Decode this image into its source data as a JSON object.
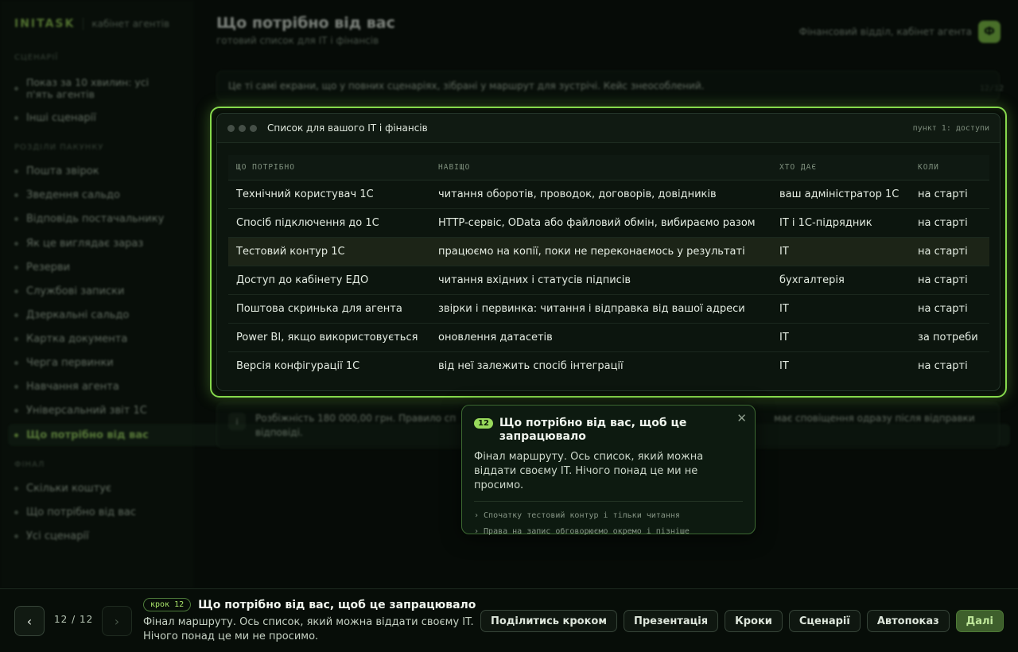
{
  "brand": {
    "logo": "INITASK",
    "subtitle": "кабінет агентів"
  },
  "sidebar": {
    "sections": {
      "scenarios": "СЦЕНАРІЇ",
      "package": "РОЗДІЛИ ПАКУНКУ",
      "next": "ФІНАЛ"
    },
    "scenario_items": [
      {
        "label": "Показ за 10 хвилин: усі п'ять агентів",
        "count": "12/12"
      },
      {
        "label": "Інші сценарії"
      }
    ],
    "items": [
      "Пошта звірок",
      "Зведення сальдо",
      "Відповідь постачальнику",
      "Як це виглядає зараз",
      "Резерви",
      "Службові записки",
      "Дзеркальні сальдо",
      "Картка документа",
      "Черга первинки",
      "Навчання агента",
      "Універсальний звіт 1С",
      "Що потрібно від вас"
    ],
    "final_items": [
      "Скільки коштує",
      "Що потрібно від вас",
      "Усі сценарії"
    ]
  },
  "header": {
    "title": "Що потрібно від вас",
    "subtitle": "готовий список для IT і фінансів",
    "right_label": "Фінансовий відділ, кабінет агента",
    "avatar": "Ф"
  },
  "notice": "Це ті самі екрани, що у повних сценаріях, зібрані у маршрут для зустрічі. Кейс знеособлений.",
  "panel": {
    "title": "Список для вашого IT і фінансів",
    "tag": "пункт 1: доступи",
    "columns": [
      "ЩО ПОТРІБНО",
      "НАВІЩО",
      "ХТО ДАЄ",
      "КОЛИ"
    ],
    "rows": [
      [
        "Технічний користувач 1С",
        "читання оборотів, проводок, договорів, довідників",
        "ваш адміністратор 1С",
        "на старті"
      ],
      [
        "Спосіб підключення до 1С",
        "HTTP-сервіс, OData або файловий обмін, вибираємо разом",
        "IT і 1С-підрядник",
        "на старті"
      ],
      [
        "Тестовий контур 1С",
        "працюємо на копії, поки не переконаємось у результаті",
        "IT",
        "на старті"
      ],
      [
        "Доступ до кабінету ЕДО",
        "читання вхідних і статусів підписів",
        "бухгалтерія",
        "на старті"
      ],
      [
        "Поштова скринька для агента",
        "звірки і первинка: читання і відправка від вашої адреси",
        "IT",
        "на старті"
      ],
      [
        "Power BI, якщо використовується",
        "оновлення датасетів",
        "IT",
        "за потреби"
      ],
      [
        "Версія конфігурації 1С",
        "від неї залежить спосіб інтеграції",
        "IT",
        "на старті"
      ]
    ]
  },
  "info_bar": {
    "icon": "i",
    "text_left": "Розбіжність 180 000,00 грн. Правило сп",
    "text_right": "має сповіщення одразу після відправки",
    "text_line2": "відповіді."
  },
  "popover": {
    "num": "12",
    "title": "Що потрібно від вас, щоб це запрацювало",
    "body": "Фінал маршруту. Ось список, який можна віддати своєму IT. Нічого понад це ми не просимо.",
    "notes": [
      "› Спочатку тестовий контур і тільки читання",
      "› Права на запис обговорюємо окремо і пізніше"
    ],
    "close": "✕"
  },
  "bottom": {
    "prev": "‹",
    "next": "›",
    "counter": "12 / 12",
    "step_badge": "крок 12",
    "step_title": "Що потрібно від вас, щоб це запрацювало",
    "step_desc": "Фінал маршруту. Ось список, який можна віддати своєму IT. Нічого понад це ми не просимо.",
    "actions": [
      "Поділитись кроком",
      "Презентація",
      "Кроки",
      "Сценарії",
      "Автопоказ"
    ],
    "primary": "Далі"
  }
}
